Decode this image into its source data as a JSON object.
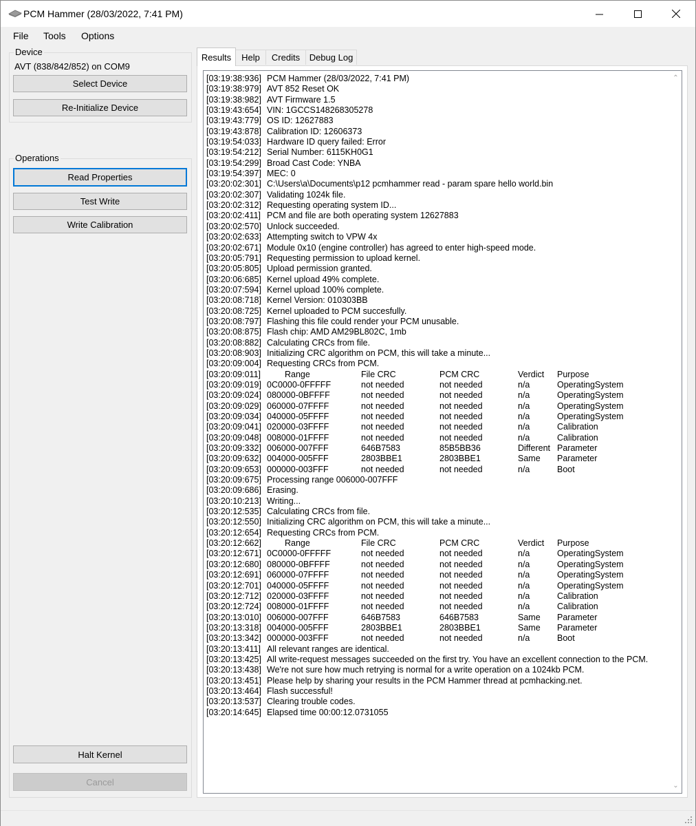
{
  "window": {
    "title": "PCM Hammer (28/03/2022, 7:41 PM)"
  },
  "menu": [
    "File",
    "Tools",
    "Options"
  ],
  "device": {
    "legend": "Device",
    "status": "AVT (838/842/852) on COM9",
    "select_label": "Select Device",
    "reinit_label": "Re-Initialize Device"
  },
  "operations": {
    "legend": "Operations",
    "read_label": "Read Properties",
    "test_label": "Test Write",
    "write_label": "Write Calibration",
    "halt_label": "Halt Kernel",
    "cancel_label": "Cancel"
  },
  "tabs": [
    "Results",
    "Help",
    "Credits",
    "Debug Log"
  ],
  "log": [
    {
      "t": "[03:19:38:936]",
      "m": "PCM Hammer (28/03/2022, 7:41 PM)"
    },
    {
      "t": "[03:19:38:979]",
      "m": "AVT 852 Reset OK"
    },
    {
      "t": "[03:19:38:982]",
      "m": "AVT Firmware 1.5"
    },
    {
      "t": "[03:19:43:654]",
      "m": "VIN: 1GCCS148268305278"
    },
    {
      "t": "[03:19:43:779]",
      "m": "OS ID: 12627883"
    },
    {
      "t": "[03:19:43:878]",
      "m": "Calibration ID: 12606373"
    },
    {
      "t": "[03:19:54:033]",
      "m": "Hardware ID query failed: Error"
    },
    {
      "t": "[03:19:54:212]",
      "m": "Serial Number: 6115KH0G1"
    },
    {
      "t": "[03:19:54:299]",
      "m": "Broad Cast Code: YNBA"
    },
    {
      "t": "[03:19:54:397]",
      "m": "MEC: 0"
    },
    {
      "t": "[03:20:02:301]",
      "m": "C:\\Users\\a\\Documents\\p12 pcmhammer read - param spare hello world.bin"
    },
    {
      "t": "[03:20:02:307]",
      "m": "Validating 1024k file."
    },
    {
      "t": "[03:20:02:312]",
      "m": "Requesting operating system ID..."
    },
    {
      "t": "[03:20:02:411]",
      "m": "PCM and file are both operating system 12627883"
    },
    {
      "t": "[03:20:02:570]",
      "m": "Unlock succeeded."
    },
    {
      "t": "[03:20:02:633]",
      "m": "Attempting switch to VPW 4x"
    },
    {
      "t": "[03:20:02:671]",
      "m": "Module 0x10 (engine controller) has agreed to enter high-speed mode."
    },
    {
      "t": "[03:20:05:791]",
      "m": "Requesting permission to upload kernel."
    },
    {
      "t": "[03:20:05:805]",
      "m": "Upload permission granted."
    },
    {
      "t": "[03:20:06:685]",
      "m": "Kernel upload 49% complete."
    },
    {
      "t": "[03:20:07:594]",
      "m": "Kernel upload 100% complete."
    },
    {
      "t": "[03:20:08:718]",
      "m": "Kernel Version: 010303BB"
    },
    {
      "t": "[03:20:08:725]",
      "m": "Kernel uploaded to PCM succesfully."
    },
    {
      "t": "[03:20:08:797]",
      "m": "Flashing this file could render your PCM unusable."
    },
    {
      "t": "[03:20:08:875]",
      "m": "Flash chip: AMD AM29BL802C, 1mb"
    },
    {
      "t": "[03:20:08:882]",
      "m": "Calculating CRCs from file."
    },
    {
      "t": "[03:20:08:903]",
      "m": "Initializing CRC algorithm on PCM, this will take a minute..."
    },
    {
      "t": "[03:20:09:004]",
      "m": "Requesting CRCs from PCM."
    },
    {
      "t": "[03:20:09:011]",
      "cols": [
        "Range",
        "File CRC",
        "PCM CRC",
        "Verdict",
        "Purpose"
      ],
      "hdr": true
    },
    {
      "t": "[03:20:09:019]",
      "cols": [
        "0C0000-0FFFFF",
        "not needed",
        "not needed",
        "n/a",
        "OperatingSystem"
      ]
    },
    {
      "t": "[03:20:09:024]",
      "cols": [
        "080000-0BFFFF",
        "not needed",
        "not needed",
        "n/a",
        "OperatingSystem"
      ]
    },
    {
      "t": "[03:20:09:029]",
      "cols": [
        "060000-07FFFF",
        "not needed",
        "not needed",
        "n/a",
        "OperatingSystem"
      ]
    },
    {
      "t": "[03:20:09:034]",
      "cols": [
        "040000-05FFFF",
        "not needed",
        "not needed",
        "n/a",
        "OperatingSystem"
      ]
    },
    {
      "t": "[03:20:09:041]",
      "cols": [
        "020000-03FFFF",
        "not needed",
        "not needed",
        "n/a",
        "Calibration"
      ]
    },
    {
      "t": "[03:20:09:048]",
      "cols": [
        "008000-01FFFF",
        "not needed",
        "not needed",
        "n/a",
        "Calibration"
      ]
    },
    {
      "t": "[03:20:09:332]",
      "cols": [
        "006000-007FFF",
        "646B7583",
        "85B5BB36",
        "Different",
        "Parameter"
      ]
    },
    {
      "t": "[03:20:09:632]",
      "cols": [
        "004000-005FFF",
        "2803BBE1",
        "2803BBE1",
        "Same",
        "Parameter"
      ]
    },
    {
      "t": "[03:20:09:653]",
      "cols": [
        "000000-003FFF",
        "not needed",
        "not needed",
        "n/a",
        "Boot"
      ]
    },
    {
      "t": "[03:20:09:675]",
      "m": "Processing range 006000-007FFF"
    },
    {
      "t": "[03:20:09:686]",
      "m": "Erasing."
    },
    {
      "t": "[03:20:10:213]",
      "m": "Writing..."
    },
    {
      "t": "[03:20:12:535]",
      "m": "Calculating CRCs from file."
    },
    {
      "t": "[03:20:12:550]",
      "m": "Initializing CRC algorithm on PCM, this will take a minute..."
    },
    {
      "t": "[03:20:12:654]",
      "m": "Requesting CRCs from PCM."
    },
    {
      "t": "[03:20:12:662]",
      "cols": [
        "Range",
        "File CRC",
        "PCM CRC",
        "Verdict",
        "Purpose"
      ],
      "hdr": true
    },
    {
      "t": "[03:20:12:671]",
      "cols": [
        "0C0000-0FFFFF",
        "not needed",
        "not needed",
        "n/a",
        "OperatingSystem"
      ]
    },
    {
      "t": "[03:20:12:680]",
      "cols": [
        "080000-0BFFFF",
        "not needed",
        "not needed",
        "n/a",
        "OperatingSystem"
      ]
    },
    {
      "t": "[03:20:12:691]",
      "cols": [
        "060000-07FFFF",
        "not needed",
        "not needed",
        "n/a",
        "OperatingSystem"
      ]
    },
    {
      "t": "[03:20:12:701]",
      "cols": [
        "040000-05FFFF",
        "not needed",
        "not needed",
        "n/a",
        "OperatingSystem"
      ]
    },
    {
      "t": "[03:20:12:712]",
      "cols": [
        "020000-03FFFF",
        "not needed",
        "not needed",
        "n/a",
        "Calibration"
      ]
    },
    {
      "t": "[03:20:12:724]",
      "cols": [
        "008000-01FFFF",
        "not needed",
        "not needed",
        "n/a",
        "Calibration"
      ]
    },
    {
      "t": "[03:20:13:010]",
      "cols": [
        "006000-007FFF",
        "646B7583",
        "646B7583",
        "Same",
        "Parameter"
      ]
    },
    {
      "t": "[03:20:13:318]",
      "cols": [
        "004000-005FFF",
        "2803BBE1",
        "2803BBE1",
        "Same",
        "Parameter"
      ]
    },
    {
      "t": "[03:20:13:342]",
      "cols": [
        "000000-003FFF",
        "not needed",
        "not needed",
        "n/a",
        "Boot"
      ]
    },
    {
      "t": "[03:20:13:411]",
      "m": "All relevant ranges are identical."
    },
    {
      "t": "[03:20:13:425]",
      "m": "All write-request messages succeeded on the first try. You have an excellent connection to the PCM."
    },
    {
      "t": "[03:20:13:438]",
      "m": "We're not sure how much retrying is normal for a write operation on a 1024kb PCM."
    },
    {
      "t": "[03:20:13:451]",
      "m": "Please help by sharing your results in the PCM Hammer thread at pcmhacking.net."
    },
    {
      "t": "[03:20:13:464]",
      "m": "Flash successful!"
    },
    {
      "t": "[03:20:13:537]",
      "m": "Clearing trouble codes."
    },
    {
      "t": "[03:20:14:645]",
      "m": "Elapsed time 00:00:12.0731055"
    }
  ]
}
